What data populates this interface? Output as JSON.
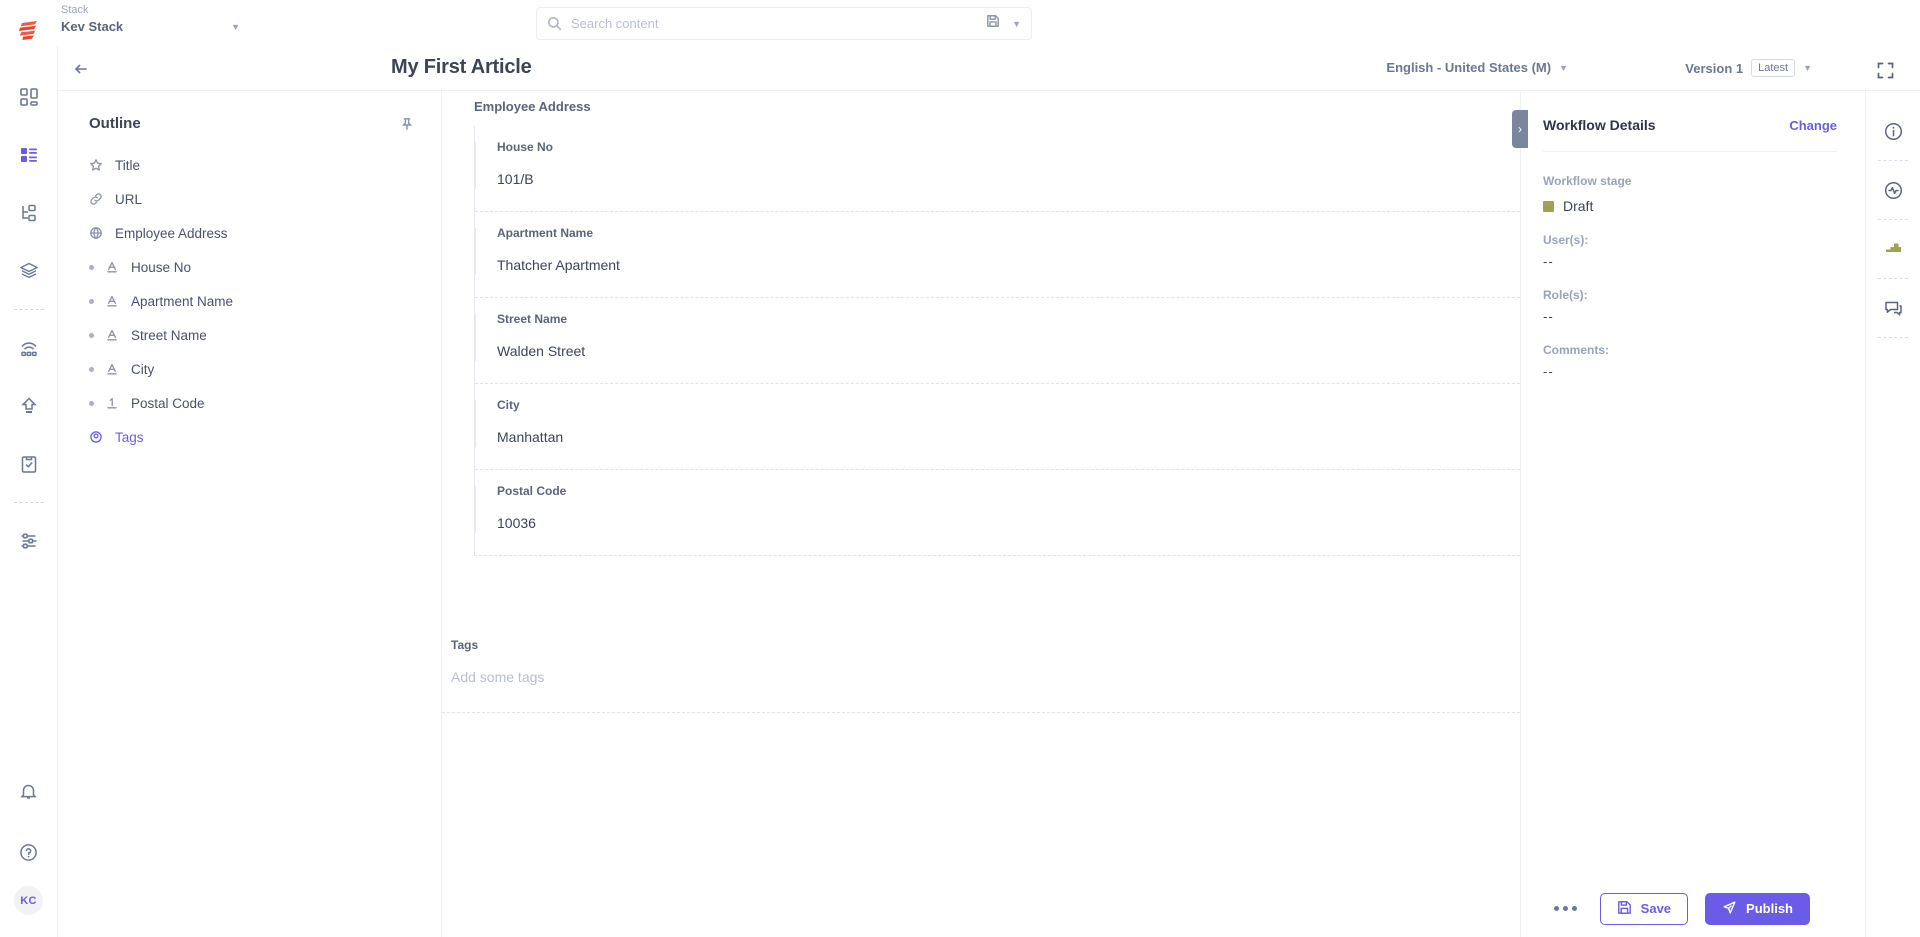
{
  "app": {
    "logo_icon": "contentstack-logo-icon"
  },
  "topbar": {
    "stack_label": "Stack",
    "stack_value": "Kev Stack",
    "stack_caret_icon": "chevron-down-icon",
    "search": {
      "placeholder": "Search content",
      "value": "",
      "search_icon": "search-icon",
      "saved_icon": "save-search-icon",
      "caret_icon": "chevron-down-icon"
    }
  },
  "sidebar": {
    "items": [
      {
        "name": "dashboard",
        "icon": "dashboard-grid-icon",
        "active": false
      },
      {
        "name": "content-types",
        "icon": "content-entries-icon",
        "active": true
      },
      {
        "name": "content-models",
        "icon": "sitemap-icon",
        "active": false
      },
      {
        "name": "assets",
        "icon": "layers-stack-icon",
        "active": false
      },
      {
        "name": "publish-queue",
        "icon": "live-preview-icon",
        "active": false
      },
      {
        "name": "releases",
        "icon": "upload-arrow-icon",
        "active": false
      },
      {
        "name": "tasks",
        "icon": "clipboard-check-icon",
        "active": false
      },
      {
        "name": "settings",
        "icon": "sliders-settings-icon",
        "active": false
      }
    ],
    "bottom": {
      "notifications_icon": "bell-icon",
      "help_icon": "question-circle-icon",
      "avatar_initials": "KC"
    }
  },
  "header": {
    "back_icon": "arrow-left-icon",
    "title": "My First Article",
    "language": {
      "label": "English - United States (M)",
      "caret_icon": "chevron-down-icon"
    },
    "version": {
      "label": "Version 1",
      "badge": "Latest",
      "caret_icon": "chevron-down-icon"
    },
    "fullscreen_icon": "fullscreen-expand-icon"
  },
  "outline": {
    "title": "Outline",
    "pin_icon": "pin-icon",
    "items": [
      {
        "label": "Title",
        "icon": "star-icon",
        "child": false,
        "active": false
      },
      {
        "label": "URL",
        "icon": "link-icon",
        "child": false,
        "active": false
      },
      {
        "label": "Employee Address",
        "icon": "globe-icon",
        "child": false,
        "active": false
      },
      {
        "label": "House No",
        "icon": "text-a-icon",
        "child": true,
        "active": false
      },
      {
        "label": "Apartment Name",
        "icon": "text-a-icon",
        "child": true,
        "active": false
      },
      {
        "label": "Street Name",
        "icon": "text-a-icon",
        "child": true,
        "active": false
      },
      {
        "label": "City",
        "icon": "text-a-icon",
        "child": true,
        "active": false
      },
      {
        "label": "Postal Code",
        "icon": "number-1-icon",
        "child": true,
        "active": false
      },
      {
        "label": "Tags",
        "icon": "tag-icon",
        "child": false,
        "active": true
      }
    ]
  },
  "content": {
    "group_label": "Employee Address",
    "fields": [
      {
        "label": "House No",
        "value": "101/B"
      },
      {
        "label": "Apartment Name",
        "value": "Thatcher Apartment"
      },
      {
        "label": "Street Name",
        "value": "Walden Street"
      },
      {
        "label": "City",
        "value": "Manhattan"
      },
      {
        "label": "Postal Code",
        "value": "10036"
      }
    ],
    "tags": {
      "label": "Tags",
      "placeholder": "Add some tags"
    }
  },
  "workflow": {
    "title": "Workflow Details",
    "change_label": "Change",
    "stage_key": "Workflow stage",
    "stage_value": "Draft",
    "stage_color": "#9da350",
    "users_key": "User(s):",
    "users_value": "--",
    "roles_key": "Role(s):",
    "roles_value": "--",
    "comments_key": "Comments:",
    "comments_value": "--",
    "collapse_icon": "chevron-right-icon"
  },
  "right_rail": {
    "items": [
      {
        "name": "details",
        "icon": "info-circle-icon"
      },
      {
        "name": "activity",
        "icon": "activity-pulse-icon"
      },
      {
        "name": "workflow",
        "icon": "workflow-stage-icon",
        "color": "#9da350",
        "active": true
      },
      {
        "name": "comments",
        "icon": "comments-icon"
      }
    ]
  },
  "footer": {
    "more_icon": "more-horizontal-icon",
    "save_label": "Save",
    "save_icon": "floppy-disk-icon",
    "publish_label": "Publish",
    "publish_icon": "publish-send-icon",
    "accent_color": "#6b5ce7"
  }
}
